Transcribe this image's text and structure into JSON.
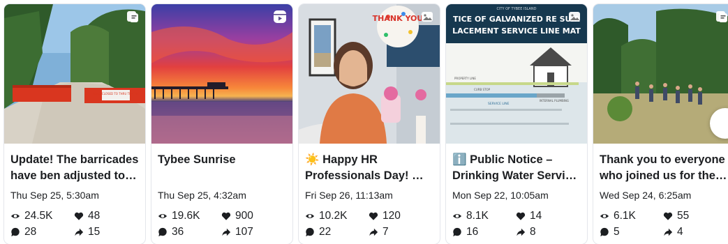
{
  "posts": [
    {
      "title": "Update! The barricades have ben adjusted to allow access",
      "date": "Thu Sep 25, 5:30am",
      "views": "24.5K",
      "likes": "48",
      "comments": "28",
      "shares": "15",
      "media_type": "photo-album-icon",
      "sign_text": "ROAD CLOSED TO THRU TRAFFIC"
    },
    {
      "title": "Tybee Sunrise",
      "date": "Thu Sep 25, 4:32am",
      "views": "19.6K",
      "likes": "900",
      "comments": "36",
      "shares": "107",
      "media_type": "reel-icon"
    },
    {
      "title": "☀️ Happy HR Professionals Day! …",
      "date": "Fri Sep 26, 11:13am",
      "views": "10.2K",
      "likes": "120",
      "comments": "22",
      "shares": "7",
      "media_type": "photo-icon",
      "balloon_text": "THANK YOU"
    },
    {
      "title": "ℹ️ Public Notice – Drinking Water Service Line",
      "date": "Mon Sep 22, 10:05am",
      "views": "8.1K",
      "likes": "14",
      "comments": "16",
      "shares": "8",
      "media_type": "photo-icon",
      "notice": {
        "city": "CITY OF TYBEE ISLAND",
        "line1": "TICE OF GALVANIZED RE SUIR",
        "line2": "LACEMENT SERVICE LINE MAT",
        "property": "PROPERTY LINE",
        "curb": "CURB STOP",
        "service": "SERVICE LINE",
        "internal": "INTERNAL PLUMBING"
      }
    },
    {
      "title": "Thank you to everyone who joined us for the event",
      "date": "Wed Sep 24, 6:25am",
      "views": "6.1K",
      "likes": "55",
      "comments": "5",
      "shares": "4",
      "media_type": "photo-album-icon"
    }
  ]
}
